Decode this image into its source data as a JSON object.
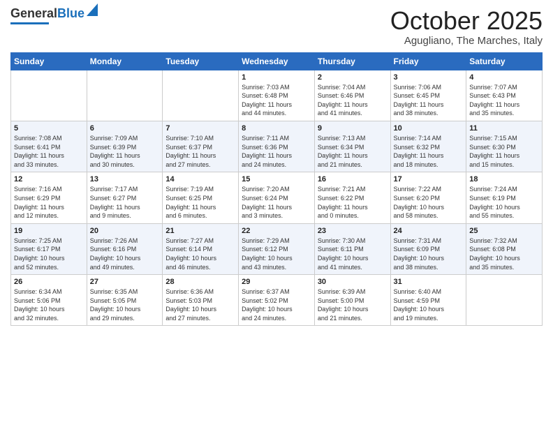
{
  "header": {
    "logo_general": "General",
    "logo_blue": "Blue",
    "title": "October 2025",
    "subtitle": "Agugliano, The Marches, Italy"
  },
  "weekdays": [
    "Sunday",
    "Monday",
    "Tuesday",
    "Wednesday",
    "Thursday",
    "Friday",
    "Saturday"
  ],
  "weeks": [
    [
      {
        "day": "",
        "info": ""
      },
      {
        "day": "",
        "info": ""
      },
      {
        "day": "",
        "info": ""
      },
      {
        "day": "1",
        "info": "Sunrise: 7:03 AM\nSunset: 6:48 PM\nDaylight: 11 hours\nand 44 minutes."
      },
      {
        "day": "2",
        "info": "Sunrise: 7:04 AM\nSunset: 6:46 PM\nDaylight: 11 hours\nand 41 minutes."
      },
      {
        "day": "3",
        "info": "Sunrise: 7:06 AM\nSunset: 6:45 PM\nDaylight: 11 hours\nand 38 minutes."
      },
      {
        "day": "4",
        "info": "Sunrise: 7:07 AM\nSunset: 6:43 PM\nDaylight: 11 hours\nand 35 minutes."
      }
    ],
    [
      {
        "day": "5",
        "info": "Sunrise: 7:08 AM\nSunset: 6:41 PM\nDaylight: 11 hours\nand 33 minutes."
      },
      {
        "day": "6",
        "info": "Sunrise: 7:09 AM\nSunset: 6:39 PM\nDaylight: 11 hours\nand 30 minutes."
      },
      {
        "day": "7",
        "info": "Sunrise: 7:10 AM\nSunset: 6:37 PM\nDaylight: 11 hours\nand 27 minutes."
      },
      {
        "day": "8",
        "info": "Sunrise: 7:11 AM\nSunset: 6:36 PM\nDaylight: 11 hours\nand 24 minutes."
      },
      {
        "day": "9",
        "info": "Sunrise: 7:13 AM\nSunset: 6:34 PM\nDaylight: 11 hours\nand 21 minutes."
      },
      {
        "day": "10",
        "info": "Sunrise: 7:14 AM\nSunset: 6:32 PM\nDaylight: 11 hours\nand 18 minutes."
      },
      {
        "day": "11",
        "info": "Sunrise: 7:15 AM\nSunset: 6:30 PM\nDaylight: 11 hours\nand 15 minutes."
      }
    ],
    [
      {
        "day": "12",
        "info": "Sunrise: 7:16 AM\nSunset: 6:29 PM\nDaylight: 11 hours\nand 12 minutes."
      },
      {
        "day": "13",
        "info": "Sunrise: 7:17 AM\nSunset: 6:27 PM\nDaylight: 11 hours\nand 9 minutes."
      },
      {
        "day": "14",
        "info": "Sunrise: 7:19 AM\nSunset: 6:25 PM\nDaylight: 11 hours\nand 6 minutes."
      },
      {
        "day": "15",
        "info": "Sunrise: 7:20 AM\nSunset: 6:24 PM\nDaylight: 11 hours\nand 3 minutes."
      },
      {
        "day": "16",
        "info": "Sunrise: 7:21 AM\nSunset: 6:22 PM\nDaylight: 11 hours\nand 0 minutes."
      },
      {
        "day": "17",
        "info": "Sunrise: 7:22 AM\nSunset: 6:20 PM\nDaylight: 10 hours\nand 58 minutes."
      },
      {
        "day": "18",
        "info": "Sunrise: 7:24 AM\nSunset: 6:19 PM\nDaylight: 10 hours\nand 55 minutes."
      }
    ],
    [
      {
        "day": "19",
        "info": "Sunrise: 7:25 AM\nSunset: 6:17 PM\nDaylight: 10 hours\nand 52 minutes."
      },
      {
        "day": "20",
        "info": "Sunrise: 7:26 AM\nSunset: 6:16 PM\nDaylight: 10 hours\nand 49 minutes."
      },
      {
        "day": "21",
        "info": "Sunrise: 7:27 AM\nSunset: 6:14 PM\nDaylight: 10 hours\nand 46 minutes."
      },
      {
        "day": "22",
        "info": "Sunrise: 7:29 AM\nSunset: 6:12 PM\nDaylight: 10 hours\nand 43 minutes."
      },
      {
        "day": "23",
        "info": "Sunrise: 7:30 AM\nSunset: 6:11 PM\nDaylight: 10 hours\nand 41 minutes."
      },
      {
        "day": "24",
        "info": "Sunrise: 7:31 AM\nSunset: 6:09 PM\nDaylight: 10 hours\nand 38 minutes."
      },
      {
        "day": "25",
        "info": "Sunrise: 7:32 AM\nSunset: 6:08 PM\nDaylight: 10 hours\nand 35 minutes."
      }
    ],
    [
      {
        "day": "26",
        "info": "Sunrise: 6:34 AM\nSunset: 5:06 PM\nDaylight: 10 hours\nand 32 minutes."
      },
      {
        "day": "27",
        "info": "Sunrise: 6:35 AM\nSunset: 5:05 PM\nDaylight: 10 hours\nand 29 minutes."
      },
      {
        "day": "28",
        "info": "Sunrise: 6:36 AM\nSunset: 5:03 PM\nDaylight: 10 hours\nand 27 minutes."
      },
      {
        "day": "29",
        "info": "Sunrise: 6:37 AM\nSunset: 5:02 PM\nDaylight: 10 hours\nand 24 minutes."
      },
      {
        "day": "30",
        "info": "Sunrise: 6:39 AM\nSunset: 5:00 PM\nDaylight: 10 hours\nand 21 minutes."
      },
      {
        "day": "31",
        "info": "Sunrise: 6:40 AM\nSunset: 4:59 PM\nDaylight: 10 hours\nand 19 minutes."
      },
      {
        "day": "",
        "info": ""
      }
    ]
  ]
}
